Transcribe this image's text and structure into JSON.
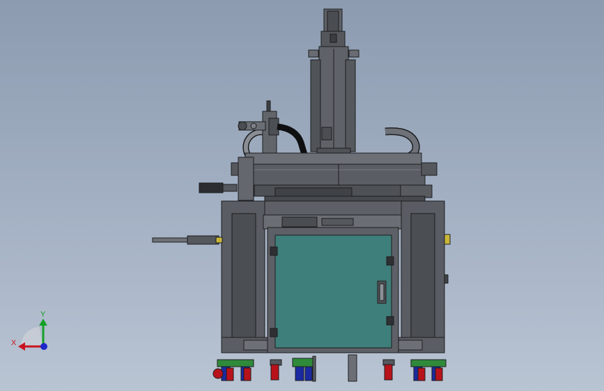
{
  "triad": {
    "x_label": "X",
    "y_label": "Y",
    "x_color": "#c8141e",
    "y_color": "#14a028",
    "z_color": "#1e28c8"
  },
  "colors": {
    "background_top": "#8c9bb0",
    "background_bottom": "#b9c4d3",
    "frame": "#5b5e63",
    "frame_dark": "#3f4246",
    "frame_light": "#7a7e84",
    "cabinet_door": "#3f7f7b",
    "caster_red": "#b8121a",
    "caster_green": "#2f8a3a",
    "caster_blue": "#1b2aa0"
  }
}
